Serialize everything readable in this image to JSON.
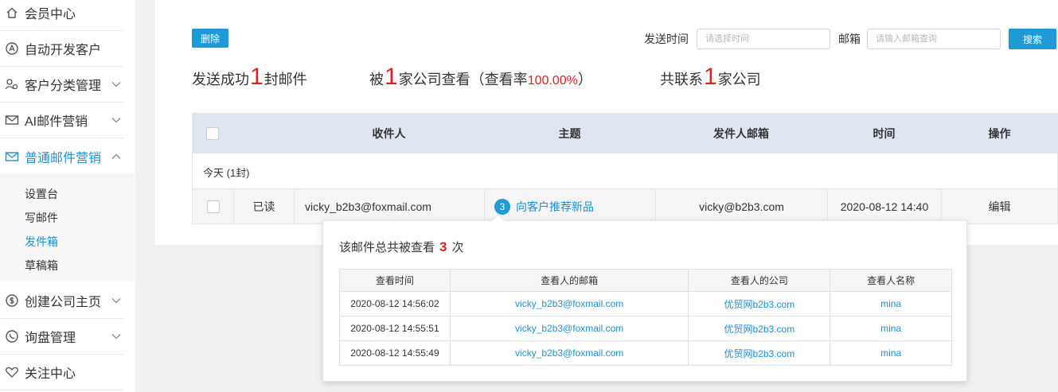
{
  "sidebar": {
    "items": [
      {
        "label": "会员中心",
        "icon": "home-icon",
        "has_chevron": false
      },
      {
        "label": "自动开发客户",
        "icon": "rocket-icon",
        "has_chevron": false
      },
      {
        "label": "客户分类管理",
        "icon": "users-icon",
        "has_chevron": true
      },
      {
        "label": "AI邮件营销",
        "icon": "mail-icon",
        "has_chevron": true
      },
      {
        "label": "普通邮件营销",
        "icon": "mail-icon",
        "has_chevron": true
      },
      {
        "label": "创建公司主页",
        "icon": "dollar-icon",
        "has_chevron": true
      },
      {
        "label": "询盘管理",
        "icon": "phone-icon",
        "has_chevron": true
      },
      {
        "label": "关注中心",
        "icon": "heart-icon",
        "has_chevron": false
      }
    ],
    "active_index": 4,
    "sub_items": [
      "设置台",
      "写邮件",
      "发件箱",
      "草稿箱"
    ],
    "active_sub_index": 2
  },
  "toolbar": {
    "delete_label": "删除",
    "send_time_label": "发送时间",
    "send_time_placeholder": "请选择时间",
    "email_label": "邮箱",
    "email_placeholder": "请输入邮箱查询",
    "search_label": "搜索"
  },
  "stats": {
    "sent_prefix": "发送成功",
    "sent_count": "1",
    "sent_suffix": "封邮件",
    "viewed_prefix": "被",
    "viewed_count": "1",
    "viewed_mid": "家公司查看（查看率",
    "viewed_rate": "100.00%",
    "viewed_suffix": "）",
    "contact_prefix": "共联系",
    "contact_count": "1",
    "contact_suffix": "家公司"
  },
  "table": {
    "headers": [
      "收件人",
      "主题",
      "发件人邮箱",
      "时间",
      "操作"
    ],
    "group_label": "今天 (1封)",
    "row": {
      "status": "已读",
      "recipient": "vicky_b2b3@foxmail.com",
      "view_count": "3",
      "subject": "向客户推荐新品",
      "sender": "vicky@b2b3.com",
      "time": "2020-08-12 14:40",
      "action": "编辑"
    }
  },
  "popup": {
    "title_prefix": "该邮件总共被查看",
    "count": "3",
    "title_suffix": "次",
    "headers": [
      "查看时间",
      "查看人的邮箱",
      "查看人的公司",
      "查看人名称"
    ],
    "rows": [
      [
        "2020-08-12 14:56:02",
        "vicky_b2b3@foxmail.com",
        "优贸网b2b3.com",
        "mina"
      ],
      [
        "2020-08-12 14:55:51",
        "vicky_b2b3@foxmail.com",
        "优贸网b2b3.com",
        "mina"
      ],
      [
        "2020-08-12 14:55:49",
        "vicky_b2b3@foxmail.com",
        "优贸网b2b3.com",
        "mina"
      ]
    ]
  },
  "colors": {
    "accent": "#1e9bd7",
    "link": "#1e8fd3",
    "highlight": "#e02020"
  }
}
